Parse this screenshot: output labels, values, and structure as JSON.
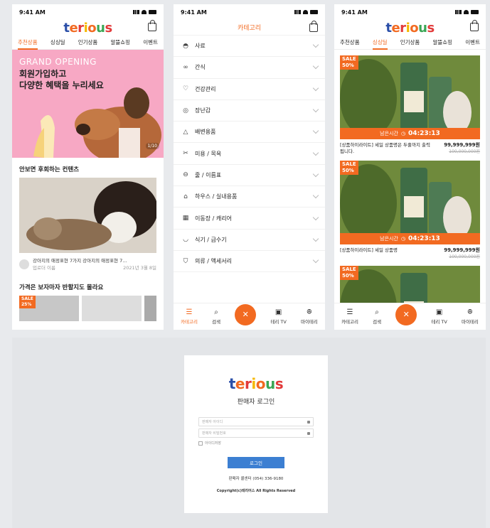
{
  "status_time": "9:41 AM",
  "logo": {
    "letters": [
      "t",
      "e",
      "r",
      "i",
      "o",
      "u",
      "s"
    ],
    "colors": [
      "#2b4fa8",
      "#f26a21",
      "#e23a3a",
      "#f5b800",
      "#f26a21",
      "#3aa655",
      "#e23a3a"
    ]
  },
  "home": {
    "tabs": [
      "추천상품",
      "싱싱딜",
      "인기상품",
      "알뜰쇼핑",
      "이벤트"
    ],
    "banner": {
      "line1": "GRAND OPENING",
      "line2": "회원가입하고\n다양한 혜택을 누리세요",
      "pager": "1/10"
    },
    "section1": "안보면 후회하는 컨텐츠",
    "content_title": "강아지의 애정표현 7가지 강아지의 애정표현 7…",
    "content_author": "업로더 이름",
    "content_date": "2021년 3월 8일",
    "section2": "가격은 보자마자 반할지도 몰라요",
    "sale_badge": "SALE\n25%"
  },
  "category": {
    "title": "카테고리",
    "items": [
      {
        "icon": "food-bowl-icon",
        "glyph": "◓",
        "label": "사료"
      },
      {
        "icon": "bone-icon",
        "glyph": "∞",
        "label": "간식"
      },
      {
        "icon": "heart-icon",
        "glyph": "♡",
        "label": "건강관리"
      },
      {
        "icon": "ball-icon",
        "glyph": "◎",
        "label": "장난감"
      },
      {
        "icon": "triangle-icon",
        "glyph": "△",
        "label": "배변용품"
      },
      {
        "icon": "scissors-icon",
        "glyph": "✂",
        "label": "미용 / 목욕"
      },
      {
        "icon": "collar-icon",
        "glyph": "⊖",
        "label": "줄 / 이름표"
      },
      {
        "icon": "house-icon",
        "glyph": "⌂",
        "label": "하우스 / 실내용품"
      },
      {
        "icon": "carrier-icon",
        "glyph": "▦",
        "label": "이동장 / 캐리어"
      },
      {
        "icon": "dish-icon",
        "glyph": "◡",
        "label": "식기 / 급수기"
      },
      {
        "icon": "shirt-icon",
        "glyph": "⛉",
        "label": "의류 / 액세서리"
      }
    ]
  },
  "bottom_nav": [
    {
      "icon": "menu-icon",
      "glyph": "☰",
      "label": "카테고리"
    },
    {
      "icon": "search-icon",
      "glyph": "⌕",
      "label": "검색"
    },
    {
      "icon": "tv-icon",
      "glyph": "▣",
      "label": "테리 TV"
    },
    {
      "icon": "paw-icon",
      "glyph": "ꔮ",
      "label": "마이테리"
    }
  ],
  "deal": {
    "products": [
      {
        "sale": "SALE\n50%",
        "timer_label": "남은시간",
        "timer": "04:23:13",
        "name": "[상품하이라이트] 세일 상품명은 두줄까지 출력됩니다.",
        "price": "99,999,999원",
        "orig": "100,000,000원"
      },
      {
        "sale": "SALE\n50%",
        "timer_label": "남은시간",
        "timer": "04:23:13",
        "name": "[상품하이라이트] 세일 상품명",
        "price": "99,999,999원",
        "orig": "100,000,000원"
      },
      {
        "sale": "SALE\n50%"
      }
    ]
  },
  "login": {
    "title": "판매자 로그인",
    "id_placeholder": "판매자 아이디",
    "pw_placeholder": "판매자 비밀번호",
    "remember": "아이디저장",
    "button": "로그인",
    "tel": "판매자 콜센터 (054) 336-9180",
    "copyright": "Copyright(c)테리어스 All Rights Reserved"
  }
}
